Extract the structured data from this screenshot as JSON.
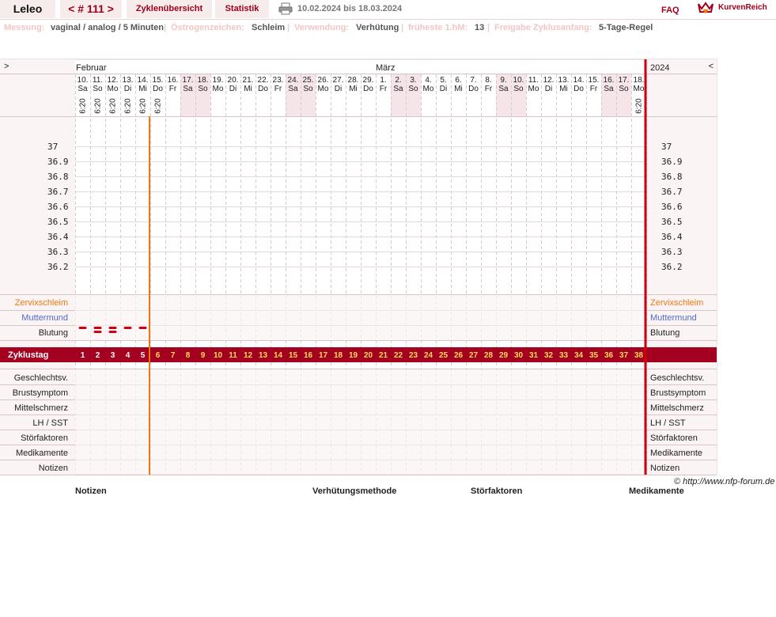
{
  "topbar": {
    "user": "Leleo",
    "cycle": "< # 111 >",
    "overview": "Zyklenübersicht",
    "stats": "Statistik",
    "print_icon": "printer-icon",
    "dates": "10.02.2024 bis 18.03.2024",
    "faq": "FAQ",
    "logo_icon": "crown-heart-icon",
    "logo": "KurvenReich"
  },
  "info": {
    "messung_label": "Messung:",
    "messung_value": "vaginal / analog / 5 Minuten",
    "oestrogen_label": "Östrogenzeichen:",
    "oestrogen_value": "Schleim",
    "verwendung_label": "Verwendung:",
    "verwendung_value": "Verhütung",
    "hm_label": "früheste 1.hM:",
    "hm_value": "13",
    "freigabe_label": "Freigabe Zyklusanfang:",
    "freigabe_value": "5-Tage-Regel",
    "separator": "|"
  },
  "chart_data": {
    "type": "table",
    "nav_prev": ">",
    "nav_next": "<",
    "months": [
      {
        "name": "Februar",
        "start_index": 0
      },
      {
        "name": "März",
        "start_index": 20
      }
    ],
    "year": "2024",
    "dates": [
      "10.",
      "11.",
      "12.",
      "13.",
      "14.",
      "15.",
      "16.",
      "17.",
      "18.",
      "19.",
      "20.",
      "21.",
      "22.",
      "23.",
      "24.",
      "25.",
      "26.",
      "27.",
      "28.",
      "29.",
      "1.",
      "2.",
      "3.",
      "4.",
      "5.",
      "6.",
      "7.",
      "8.",
      "9.",
      "10.",
      "11.",
      "12.",
      "13.",
      "14.",
      "15.",
      "16.",
      "17.",
      "18."
    ],
    "weekdays": [
      "Sa",
      "So",
      "Mo",
      "Di",
      "Mi",
      "Do",
      "Fr",
      "Sa",
      "So",
      "Mo",
      "Di",
      "Mi",
      "Do",
      "Fr",
      "Sa",
      "So",
      "Mo",
      "Di",
      "Mi",
      "Do",
      "Fr",
      "Sa",
      "So",
      "Mo",
      "Di",
      "Mi",
      "Do",
      "Fr",
      "Sa",
      "So",
      "Mo",
      "Di",
      "Mi",
      "Do",
      "Fr",
      "Sa",
      "So",
      "Mo"
    ],
    "weekend_indices": [
      7,
      8,
      14,
      15,
      21,
      22,
      28,
      29,
      35,
      36
    ],
    "times": [
      "6:20",
      "6:20",
      "6:20",
      "6:20",
      "6:20",
      "6:20",
      "",
      "",
      "",
      "",
      "",
      "",
      "",
      "",
      "",
      "",
      "",
      "",
      "",
      "",
      "",
      "",
      "",
      "",
      "",
      "",
      "",
      "",
      "",
      "",
      "",
      "",
      "",
      "",
      "",
      "",
      "",
      "6:20"
    ],
    "temp_labels": [
      "37",
      "36.9",
      "36.8",
      "36.7",
      "36.6",
      "36.5",
      "36.4",
      "36.3",
      "36.2"
    ],
    "upper_rows": {
      "zervix": "Zervixschleim",
      "muttermund": "Muttermund",
      "blutung": "Blutung"
    },
    "bleeding": [
      {
        "day": 0,
        "level": 1
      },
      {
        "day": 1,
        "level": 2
      },
      {
        "day": 2,
        "level": 2
      },
      {
        "day": 3,
        "level": 1
      },
      {
        "day": 4,
        "level": 1
      }
    ],
    "cycle_label": "Zyklustag",
    "cycle_days": [
      "1",
      "2",
      "3",
      "4",
      "5",
      "6",
      "7",
      "8",
      "9",
      "10",
      "11",
      "12",
      "13",
      "14",
      "15",
      "16",
      "17",
      "18",
      "19",
      "20",
      "21",
      "22",
      "23",
      "24",
      "25",
      "26",
      "27",
      "28",
      "29",
      "30",
      "31",
      "32",
      "33",
      "34",
      "35",
      "36",
      "37",
      "38"
    ],
    "lower_rows": [
      "Geschlechtsv.",
      "Brustsymptom",
      "Mittelschmerz",
      "LH / SST",
      "Störfaktoren",
      "Medikamente",
      "Notizen"
    ],
    "colors": {
      "primary": "#a0001c",
      "bar": "#a40020",
      "bar_text_past": "#ffffff",
      "bar_text_future": "#ffdd55",
      "orange": "#ee7711",
      "blue": "#5566cc",
      "weekend": "#f5e4e8",
      "cell": "#fbf4f4",
      "grid": "#d8c4c4"
    }
  },
  "notes": {
    "notizen": "Notizen",
    "verhuetung": "Verhütungsmethode",
    "stoerfaktoren": "Störfaktoren",
    "medikamente": "Medikamente"
  },
  "copyright": "© http://www.nfp-forum.de"
}
